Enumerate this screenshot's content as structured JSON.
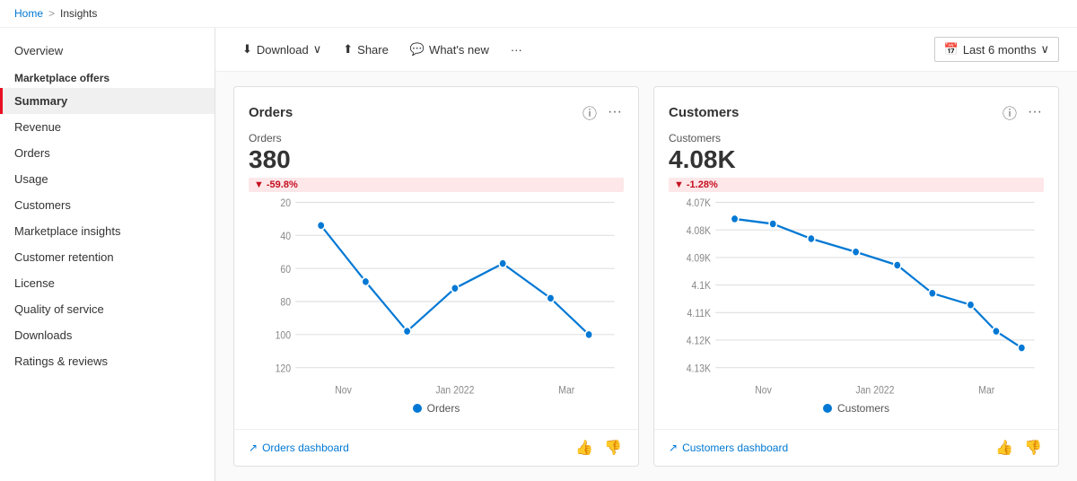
{
  "breadcrumb": {
    "home": "Home",
    "separator": ">",
    "current": "Insights"
  },
  "sidebar": {
    "overview_label": "Overview",
    "section_label": "Marketplace offers",
    "items": [
      {
        "id": "summary",
        "label": "Summary",
        "active": true
      },
      {
        "id": "revenue",
        "label": "Revenue",
        "active": false
      },
      {
        "id": "orders",
        "label": "Orders",
        "active": false
      },
      {
        "id": "usage",
        "label": "Usage",
        "active": false
      },
      {
        "id": "customers",
        "label": "Customers",
        "active": false
      },
      {
        "id": "marketplace-insights",
        "label": "Marketplace insights",
        "active": false
      },
      {
        "id": "customer-retention",
        "label": "Customer retention",
        "active": false
      },
      {
        "id": "license",
        "label": "License",
        "active": false
      },
      {
        "id": "quality-of-service",
        "label": "Quality of service",
        "active": false
      },
      {
        "id": "downloads",
        "label": "Downloads",
        "active": false
      },
      {
        "id": "ratings-reviews",
        "label": "Ratings & reviews",
        "active": false
      }
    ]
  },
  "toolbar": {
    "download_label": "Download",
    "share_label": "Share",
    "whats_new_label": "What's new",
    "more_label": "...",
    "date_range_label": "Last 6 months"
  },
  "cards": [
    {
      "id": "orders",
      "title": "Orders",
      "metric_label": "Orders",
      "metric_value": "380",
      "metric_change": "-59.8%",
      "footer_link": "Orders dashboard",
      "legend_label": "Orders",
      "chart": {
        "x_labels": [
          "Nov",
          "Jan 2022",
          "Mar"
        ],
        "y_labels": [
          "20",
          "40",
          "60",
          "80",
          "100",
          "120"
        ],
        "points": [
          {
            "x": 0.08,
            "y": 0.14
          },
          {
            "x": 0.22,
            "y": 0.48
          },
          {
            "x": 0.35,
            "y": 0.78
          },
          {
            "x": 0.5,
            "y": 0.52
          },
          {
            "x": 0.65,
            "y": 0.37
          },
          {
            "x": 0.8,
            "y": 0.58
          },
          {
            "x": 0.92,
            "y": 0.8
          }
        ]
      }
    },
    {
      "id": "customers",
      "title": "Customers",
      "metric_label": "Customers",
      "metric_value": "4.08K",
      "metric_change": "-1.28%",
      "footer_link": "Customers dashboard",
      "legend_label": "Customers",
      "chart": {
        "x_labels": [
          "Nov",
          "Jan 2022",
          "Mar"
        ],
        "y_labels": [
          "4.07K",
          "4.08K",
          "4.09K",
          "4.1K",
          "4.11K",
          "4.12K",
          "4.13K"
        ],
        "points": [
          {
            "x": 0.06,
            "y": 0.1
          },
          {
            "x": 0.18,
            "y": 0.13
          },
          {
            "x": 0.3,
            "y": 0.22
          },
          {
            "x": 0.44,
            "y": 0.3
          },
          {
            "x": 0.57,
            "y": 0.38
          },
          {
            "x": 0.68,
            "y": 0.55
          },
          {
            "x": 0.8,
            "y": 0.62
          },
          {
            "x": 0.88,
            "y": 0.78
          },
          {
            "x": 0.96,
            "y": 0.88
          }
        ]
      }
    }
  ],
  "icons": {
    "download": "⬇",
    "share": "⬆",
    "whats_new": "💬",
    "more": "···",
    "calendar": "📅",
    "chevron_down": "∨",
    "info": "ⓘ",
    "ellipsis": "···",
    "trend": "↗",
    "thumb_up": "👍",
    "thumb_down": "👎",
    "arrow_down": "▼"
  }
}
